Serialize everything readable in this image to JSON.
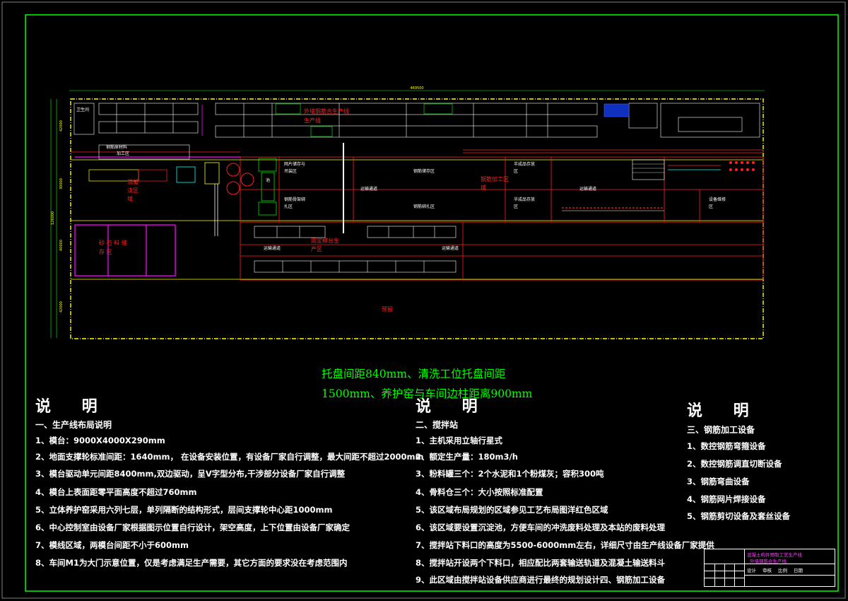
{
  "drawing": {
    "layout_labels": {
      "gate_room": "卫生间",
      "rebar_store_top": "钢筋原材料",
      "rebar_store_sub": "加工区",
      "shell_line": "外墙钢筋合生产线",
      "shell_line2": "生产线",
      "mesh_store_1": "网片储存与",
      "mesh_store_2": "吊装区",
      "steel_cage_area": "钢筋储存区",
      "semi_1": "半成品存放",
      "semi_1b": "区",
      "rebar_work": "钢筋加工区",
      "rebar_work_b": "域",
      "pour_area_a": "混凝",
      "pour_area_b": "浇区",
      "pour_area_c": "域",
      "mesh_weld_1": "钢筋骨架绑",
      "mesh_weld_2": "扎区",
      "steel_cage_area2": "钢筋绑扎区",
      "semi_2": "半成品存放",
      "semi_2b": "区",
      "equip_1": "设备维修",
      "equip_2": "区",
      "aisle_1": "运输通道",
      "aisle_2": "运输通道",
      "aisle_3": "运输通道",
      "aisle_4": "运输通道",
      "sand_store": "砂  石  料  储",
      "sand_store_b": "存  区",
      "fixed_line_a": "固定模台生",
      "fixed_line_b": "产区",
      "yard": "预留",
      "green_box": "池"
    },
    "dims": {
      "top_total": "469500",
      "left_1": "42000",
      "left_2": "30000",
      "left_3": "40000",
      "left_total": "126000",
      "left_4": "42000"
    }
  },
  "note_green": {
    "line1": "托盘间距840mm、清洗工位托盘间距",
    "line2": "1500mm、养护窑与车间边柱距离900mm"
  },
  "col1": {
    "title": "说  明",
    "section": "一、生产线布局说明",
    "items": [
      "1、模台：9000X4000X290mm",
      "2、地面支撑轮标准间距：1640mm，  在设备安装位置，有设备厂家自行调整，最大间距不超过2000mm",
      "3、模台驱动单元间距8400mm,双边驱动，呈V字型分布,干涉部分设备厂家自行调整",
      "4、模台上表面距零平面高度不超过760mm",
      "5、立体养护窑采用六列七层，单列隔断的结构形式，层间支撑轮中心距1000mm",
      "6、中心控制室由设备厂家根据图示位置自行设计，架空高度，上下位置由设备厂家确定",
      "7、模线区域，两模台间距不小于600mm",
      "8、车间M1为大门示意位置，仅是考虑满足生产需要，其它方面的要求没在考虑范围内"
    ]
  },
  "col2": {
    "title": "说  明",
    "section": "二、搅拌站",
    "items": [
      "1、主机采用立轴行星式",
      "2、额定生产量：180m3/h",
      "3、粉料罐三个：2个水泥和1个粉煤灰；容积300吨",
      "4、骨料仓三个：大小按照标准配置",
      "5、该区域布局规划的区域参见工艺布局图洋红色区域",
      "6、该区域要设置沉淀池，方便车间的冲洗废料处理及本站的废料处理",
      "7、搅拌站下料口的高度为5500-6000mm左右，详细尺寸由生产线设备厂家提供",
      "8、搅拌站开设两个下料口，相应配比两套输送轨道及混凝土输送料斗",
      "9、此区域由搅拌站设备供应商进行最终的规划设计四、钢筋加工设备"
    ]
  },
  "col3": {
    "title": "说  明",
    "section": "三、钢筋加工设备",
    "items": [
      "1、数控钢筋弯箍设备",
      "2、数控钢筋调直切断设备",
      "3、钢筋弯曲设备",
      "4、钢筋网片焊接设备",
      "5、钢筋剪切设备及套丝设备"
    ]
  },
  "title_block": {
    "line1": "混凝土构件预制工艺生产线",
    "line2": "外墙钢筋合生产线",
    "cells": [
      "设计",
      "审核",
      "比例",
      "日期"
    ]
  },
  "colors": {
    "frame": "#00ff00",
    "wall": "#ffff00",
    "accent_red": "#ff0000",
    "magenta": "#ff00ff"
  }
}
